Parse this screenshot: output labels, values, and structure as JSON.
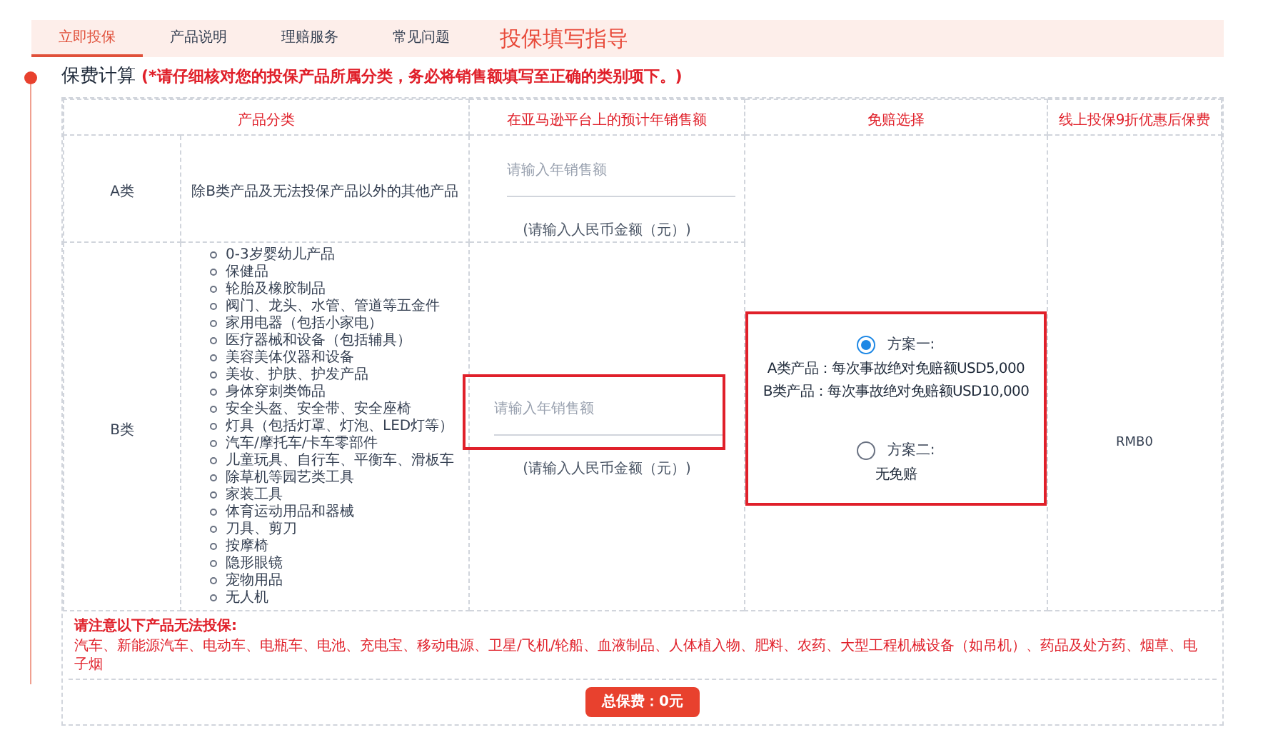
{
  "tabs": [
    {
      "label": "立即投保",
      "selected": true
    },
    {
      "label": "产品说明",
      "selected": false
    },
    {
      "label": "理赔服务",
      "selected": false
    },
    {
      "label": "常见问题",
      "selected": false
    }
  ],
  "guide_title": "投保填写指导",
  "section": {
    "title": "保费计算",
    "notice": "(*请仔细核对您的投保产品所属分类，务必将销售额填写至正确的类别项下。)"
  },
  "table": {
    "columns": [
      "产品分类",
      "在亚马逊平台上的预计年销售额",
      "免赔选择",
      "线上投保9折优惠后保费"
    ],
    "rows": [
      {
        "category": "A类",
        "products": {
          "kind": "text",
          "text": "除B类产品及无法投保产品以外的其他产品"
        },
        "sales": {
          "placeholder": "请输入年销售额",
          "hint": "(请输入人民币金额（元）)",
          "highlighted": false
        }
      },
      {
        "category": "B类",
        "products": {
          "kind": "list",
          "items": [
            "0-3岁婴幼儿产品",
            "保健品",
            "轮胎及橡胶制品",
            "阀门、龙头、水管、管道等五金件",
            "家用电器（包括小家电）",
            "医疗器械和设备（包括辅具）",
            "美容美体仪器和设备",
            "美妆、护肤、护发产品",
            "身体穿刺类饰品",
            "安全头盔、安全带、安全座椅",
            "灯具（包括灯罩、灯泡、LED灯等）",
            "汽车/摩托车/卡车零部件",
            "儿童玩具、自行车、平衡车、滑板车",
            "除草机等园艺类工具",
            "家装工具",
            "体育运动用品和器械",
            "刀具、剪刀",
            "按摩椅",
            "隐形眼镜",
            "宠物用品",
            "无人机"
          ]
        },
        "sales": {
          "placeholder": "请输入年销售额",
          "hint": "(请输入人民币金额（元）)",
          "highlighted": true
        }
      }
    ],
    "deductible": {
      "highlighted": true,
      "options": [
        {
          "label": "方案一:",
          "selected": true,
          "lines": [
            "A类产品：每次事故绝对免赔额USD5,000",
            "B类产品：每次事故绝对免赔额USD10,000"
          ]
        },
        {
          "label": "方案二:",
          "selected": false,
          "lines": [
            "无免赔"
          ]
        }
      ]
    },
    "premium": "RMB0"
  },
  "exclusions": {
    "title": "请注意以下产品无法投保:",
    "text": "汽车、新能源汽车、电动车、电瓶车、电池、充电宝、移动电源、卫星/飞机/轮船、血液制品、人体植入物、肥料、农药、大型工程机械设备（如吊机）、药品及处方药、烟草、电子烟"
  },
  "total_button": "总保费：0元"
}
